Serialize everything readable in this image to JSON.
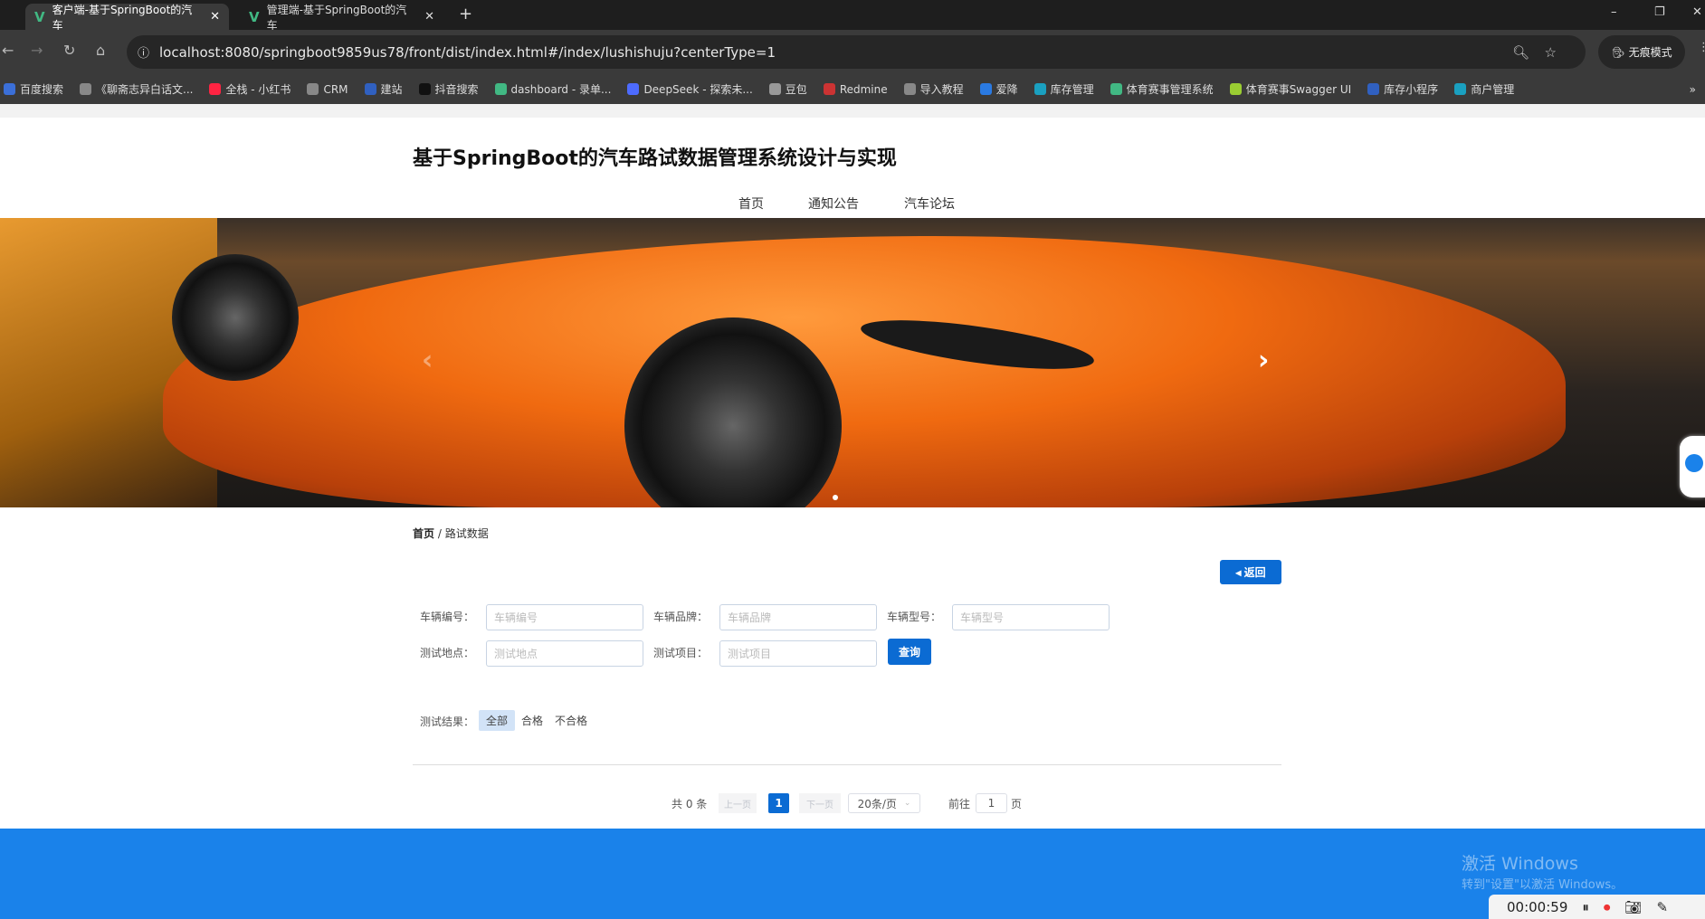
{
  "browser": {
    "tabs": [
      {
        "label": "客户端-基于SpringBoot的汽车",
        "active": true
      },
      {
        "label": "管理端-基于SpringBoot的汽车",
        "active": false
      }
    ],
    "url": "localhost:8080/springboot9859us78/front/dist/index.html#/index/lushishuju?centerType=1",
    "incognito_label": "无痕模式",
    "bookmarks": [
      "百度搜索",
      "《聊斋志异白话文...",
      "全栈 - 小红书",
      "CRM",
      "建站",
      "抖音搜索",
      "dashboard - 录单...",
      "DeepSeek - 探索未...",
      "豆包",
      "Redmine",
      "导入教程",
      "爱降",
      "库存管理",
      "体育赛事管理系统",
      "体育赛事Swagger UI",
      "库存小程序",
      "商户管理"
    ]
  },
  "site": {
    "title": "基于SpringBoot的汽车路试数据管理系统设计与实现",
    "nav": [
      "首页",
      "通知公告",
      "汽车论坛"
    ]
  },
  "breadcrumb": {
    "home": "首页",
    "sep": "/",
    "current": "路试数据"
  },
  "back_label": "返回",
  "form": {
    "fields": [
      {
        "label": "车辆编号：",
        "placeholder": "车辆编号"
      },
      {
        "label": "车辆品牌：",
        "placeholder": "车辆品牌"
      },
      {
        "label": "车辆型号：",
        "placeholder": "车辆型号"
      },
      {
        "label": "测试地点：",
        "placeholder": "测试地点"
      },
      {
        "label": "测试项目：",
        "placeholder": "测试项目"
      }
    ],
    "search_label": "查询",
    "result_label": "测试结果：",
    "result_options": [
      "全部",
      "合格",
      "不合格"
    ],
    "result_selected": "全部"
  },
  "pagination": {
    "total": "共 0 条",
    "prev": "上一页",
    "current": "1",
    "next": "下一页",
    "page_size": "20条/页",
    "goto_label": "前往",
    "goto_value": "1",
    "page_unit": "页"
  },
  "overlay": {
    "watermark_title": "激活 Windows",
    "watermark_sub": "转到\"设置\"以激活 Windows。",
    "timer": "00:00:59"
  },
  "colors": {
    "primary": "#0b6bd3",
    "footer": "#1a82ea"
  }
}
